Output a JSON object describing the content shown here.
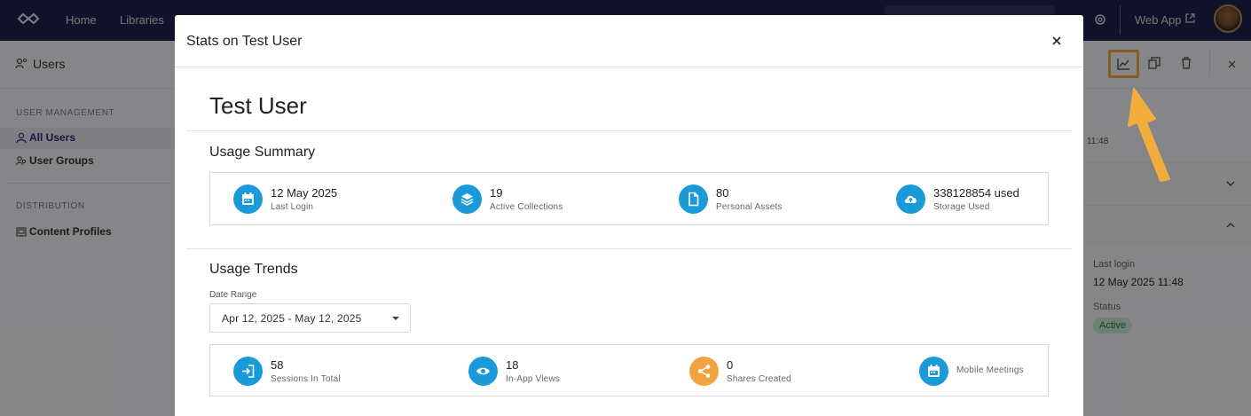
{
  "nav": {
    "links": [
      "Home",
      "Libraries"
    ],
    "web_app": "Web App"
  },
  "sidebar": {
    "title": "Users",
    "sections": [
      {
        "heading": "USER MANAGEMENT",
        "items": [
          "All Users",
          "User Groups"
        ]
      },
      {
        "heading": "DISTRIBUTION",
        "items": [
          "Content Profiles"
        ]
      }
    ]
  },
  "details_panel": {
    "time_fragment": "11:48",
    "last_login_label": "Last login",
    "last_login_value": "12 May 2025 11:48",
    "status_label": "Status",
    "status_value": "Active",
    "status_color": "#237a3c"
  },
  "modal": {
    "title": "Stats on Test User",
    "user_name": "Test User",
    "usage_summary": {
      "title": "Usage Summary",
      "stats": [
        {
          "icon": "calendar-icon",
          "value": "12 May 2025",
          "caption": "Last Login"
        },
        {
          "icon": "layers-icon",
          "value": "19",
          "caption": "Active Collections"
        },
        {
          "icon": "document-icon",
          "value": "80",
          "caption": "Personal Assets"
        },
        {
          "icon": "cloud-upload-icon",
          "value": "338128854 used",
          "caption": "Storage Used"
        }
      ]
    },
    "usage_trends": {
      "title": "Usage Trends",
      "date_range_label": "Date Range",
      "date_range_value": "Apr 12, 2025 - May 12, 2025",
      "stats": [
        {
          "icon": "login-icon",
          "value": "58",
          "caption": "Sessions In Total"
        },
        {
          "icon": "eye-icon",
          "value": "18",
          "caption": "In-App Views"
        },
        {
          "icon": "share-icon",
          "value": "0",
          "caption": "Shares Created"
        },
        {
          "icon": "calendar-icon",
          "value": "",
          "caption": "Mobile Meetings"
        }
      ]
    }
  },
  "colors": {
    "nav_bg": "#22204d",
    "accent_blue": "#1a9ad9",
    "accent_orange": "#f2a341",
    "highlight": "#f3ad3c"
  }
}
